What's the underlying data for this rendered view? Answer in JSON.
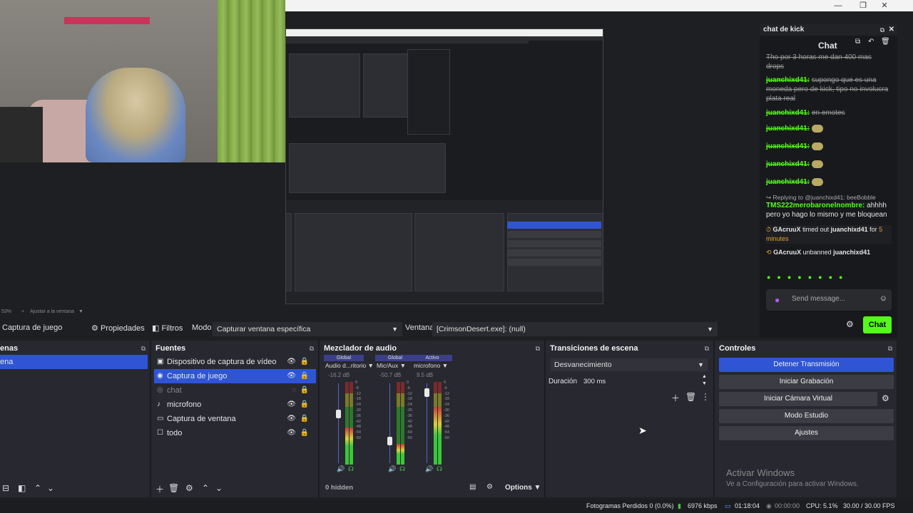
{
  "window": {
    "minimize": "—",
    "maximize": "❐",
    "close": "✕"
  },
  "zoom": {
    "level": "53%",
    "fit_label": "Ajustar a la ventana"
  },
  "propbar": {
    "source_name": "Captura de juego",
    "properties_label": "Propiedades",
    "filters_label": "Filtros",
    "mode_label": "Modo",
    "mode_value": "Capturar ventana específica",
    "window_label": "Ventana",
    "window_value": "[CrimsonDesert.exe]: (null)"
  },
  "scenes": {
    "title": "enas",
    "selected": "ena"
  },
  "sources": {
    "title": "Fuentes",
    "items": [
      {
        "label": "Dispositivo de captura de vídeo",
        "icon": "camera-icon",
        "selected": false
      },
      {
        "label": "Captura de juego",
        "icon": "gamepad-icon",
        "selected": true
      },
      {
        "label": "chat",
        "icon": "globe-icon",
        "selected": false
      },
      {
        "label": "microfono",
        "icon": "microphone-icon",
        "selected": false
      },
      {
        "label": "Captura de ventana",
        "icon": "window-icon",
        "selected": false
      },
      {
        "label": "todo",
        "icon": "monitor-icon",
        "selected": false
      }
    ]
  },
  "mixer": {
    "title": "Mezclador de audio",
    "hidden_label": "0 hidden",
    "options_label": "Options",
    "channels": [
      {
        "tag": "Global",
        "name": "Audio d...ritorio",
        "db": "-16.2 dB",
        "level": 0.45,
        "fader": 0.62
      },
      {
        "tag": "Global",
        "name": "Mic/Aux",
        "db": "-50.7 dB",
        "level": 0.25,
        "fader": 0.28
      },
      {
        "tag": "Activo",
        "name": "microfono",
        "db": "9.5 dB",
        "level": 0.7,
        "fader": 0.88
      }
    ],
    "scale": [
      "0",
      "-6",
      "-12",
      "-18",
      "-24",
      "-30",
      "-36",
      "-42",
      "-48",
      "-54",
      "-60"
    ]
  },
  "transitions": {
    "title": "Transiciones de escena",
    "type": "Desvanecimiento",
    "duration_label": "Duración",
    "duration_value": "300 ms"
  },
  "controls": {
    "title": "Controles",
    "stop_stream": "Detener Transmisión",
    "start_record": "Iniciar Grabación",
    "virtual_cam": "Iniciar Cámara Virtual",
    "studio_mode": "Modo Estudio",
    "settings": "Ajustes"
  },
  "watermark": {
    "line1": "Activar Windows",
    "line2": "Ve a Configuración para activar Windows."
  },
  "chat": {
    "dock_title": "chat de kick",
    "title": "Chat",
    "top_partial_line1": "Tho por 3 horas me dan 400 mas",
    "top_partial_line2": "drops",
    "messages": [
      {
        "user": "juanchixd41:",
        "text": "supongo que es una moneda pero de kick, tipo no involucra plata real",
        "struck": true
      },
      {
        "user": "juanchixd41:",
        "text": "en emotes",
        "struck": true
      },
      {
        "user": "juanchixd41:",
        "text": "",
        "struck": true
      },
      {
        "user": "juanchixd41:",
        "text": "",
        "struck": true
      },
      {
        "user": "juanchixd41:",
        "text": "",
        "struck": true
      },
      {
        "user": "juanchixd41:",
        "text": "",
        "struck": true
      }
    ],
    "reply_to": "Replying to @juanchixd41: beeBobble",
    "reply_user": "TMS222merobaronelnombre:",
    "reply_text": "ahhhh pero yo hago lo mismo y me bloquean",
    "mod1_user": "GAcruuX",
    "mod1_action": "timed out",
    "mod1_target": "juanchixd41",
    "mod1_for": "for",
    "mod1_duration": "5 minutes",
    "mod2_user": "GAcruuX",
    "mod2_action": "unbanned",
    "mod2_target": "juanchixd41",
    "placeholder": "Send message...",
    "send_label": "Chat"
  },
  "status": {
    "dropped": "Fotogramas Perdidos 0 (0.0%)",
    "bitrate": "6976 kbps",
    "live_time": "01:18:04",
    "rec_time": "00:00:00",
    "cpu": "CPU: 5.1%",
    "fps": "30.00 / 30.00 FPS"
  },
  "colors": {
    "accent": "#2f55d4",
    "kick_green": "#53fc18"
  }
}
